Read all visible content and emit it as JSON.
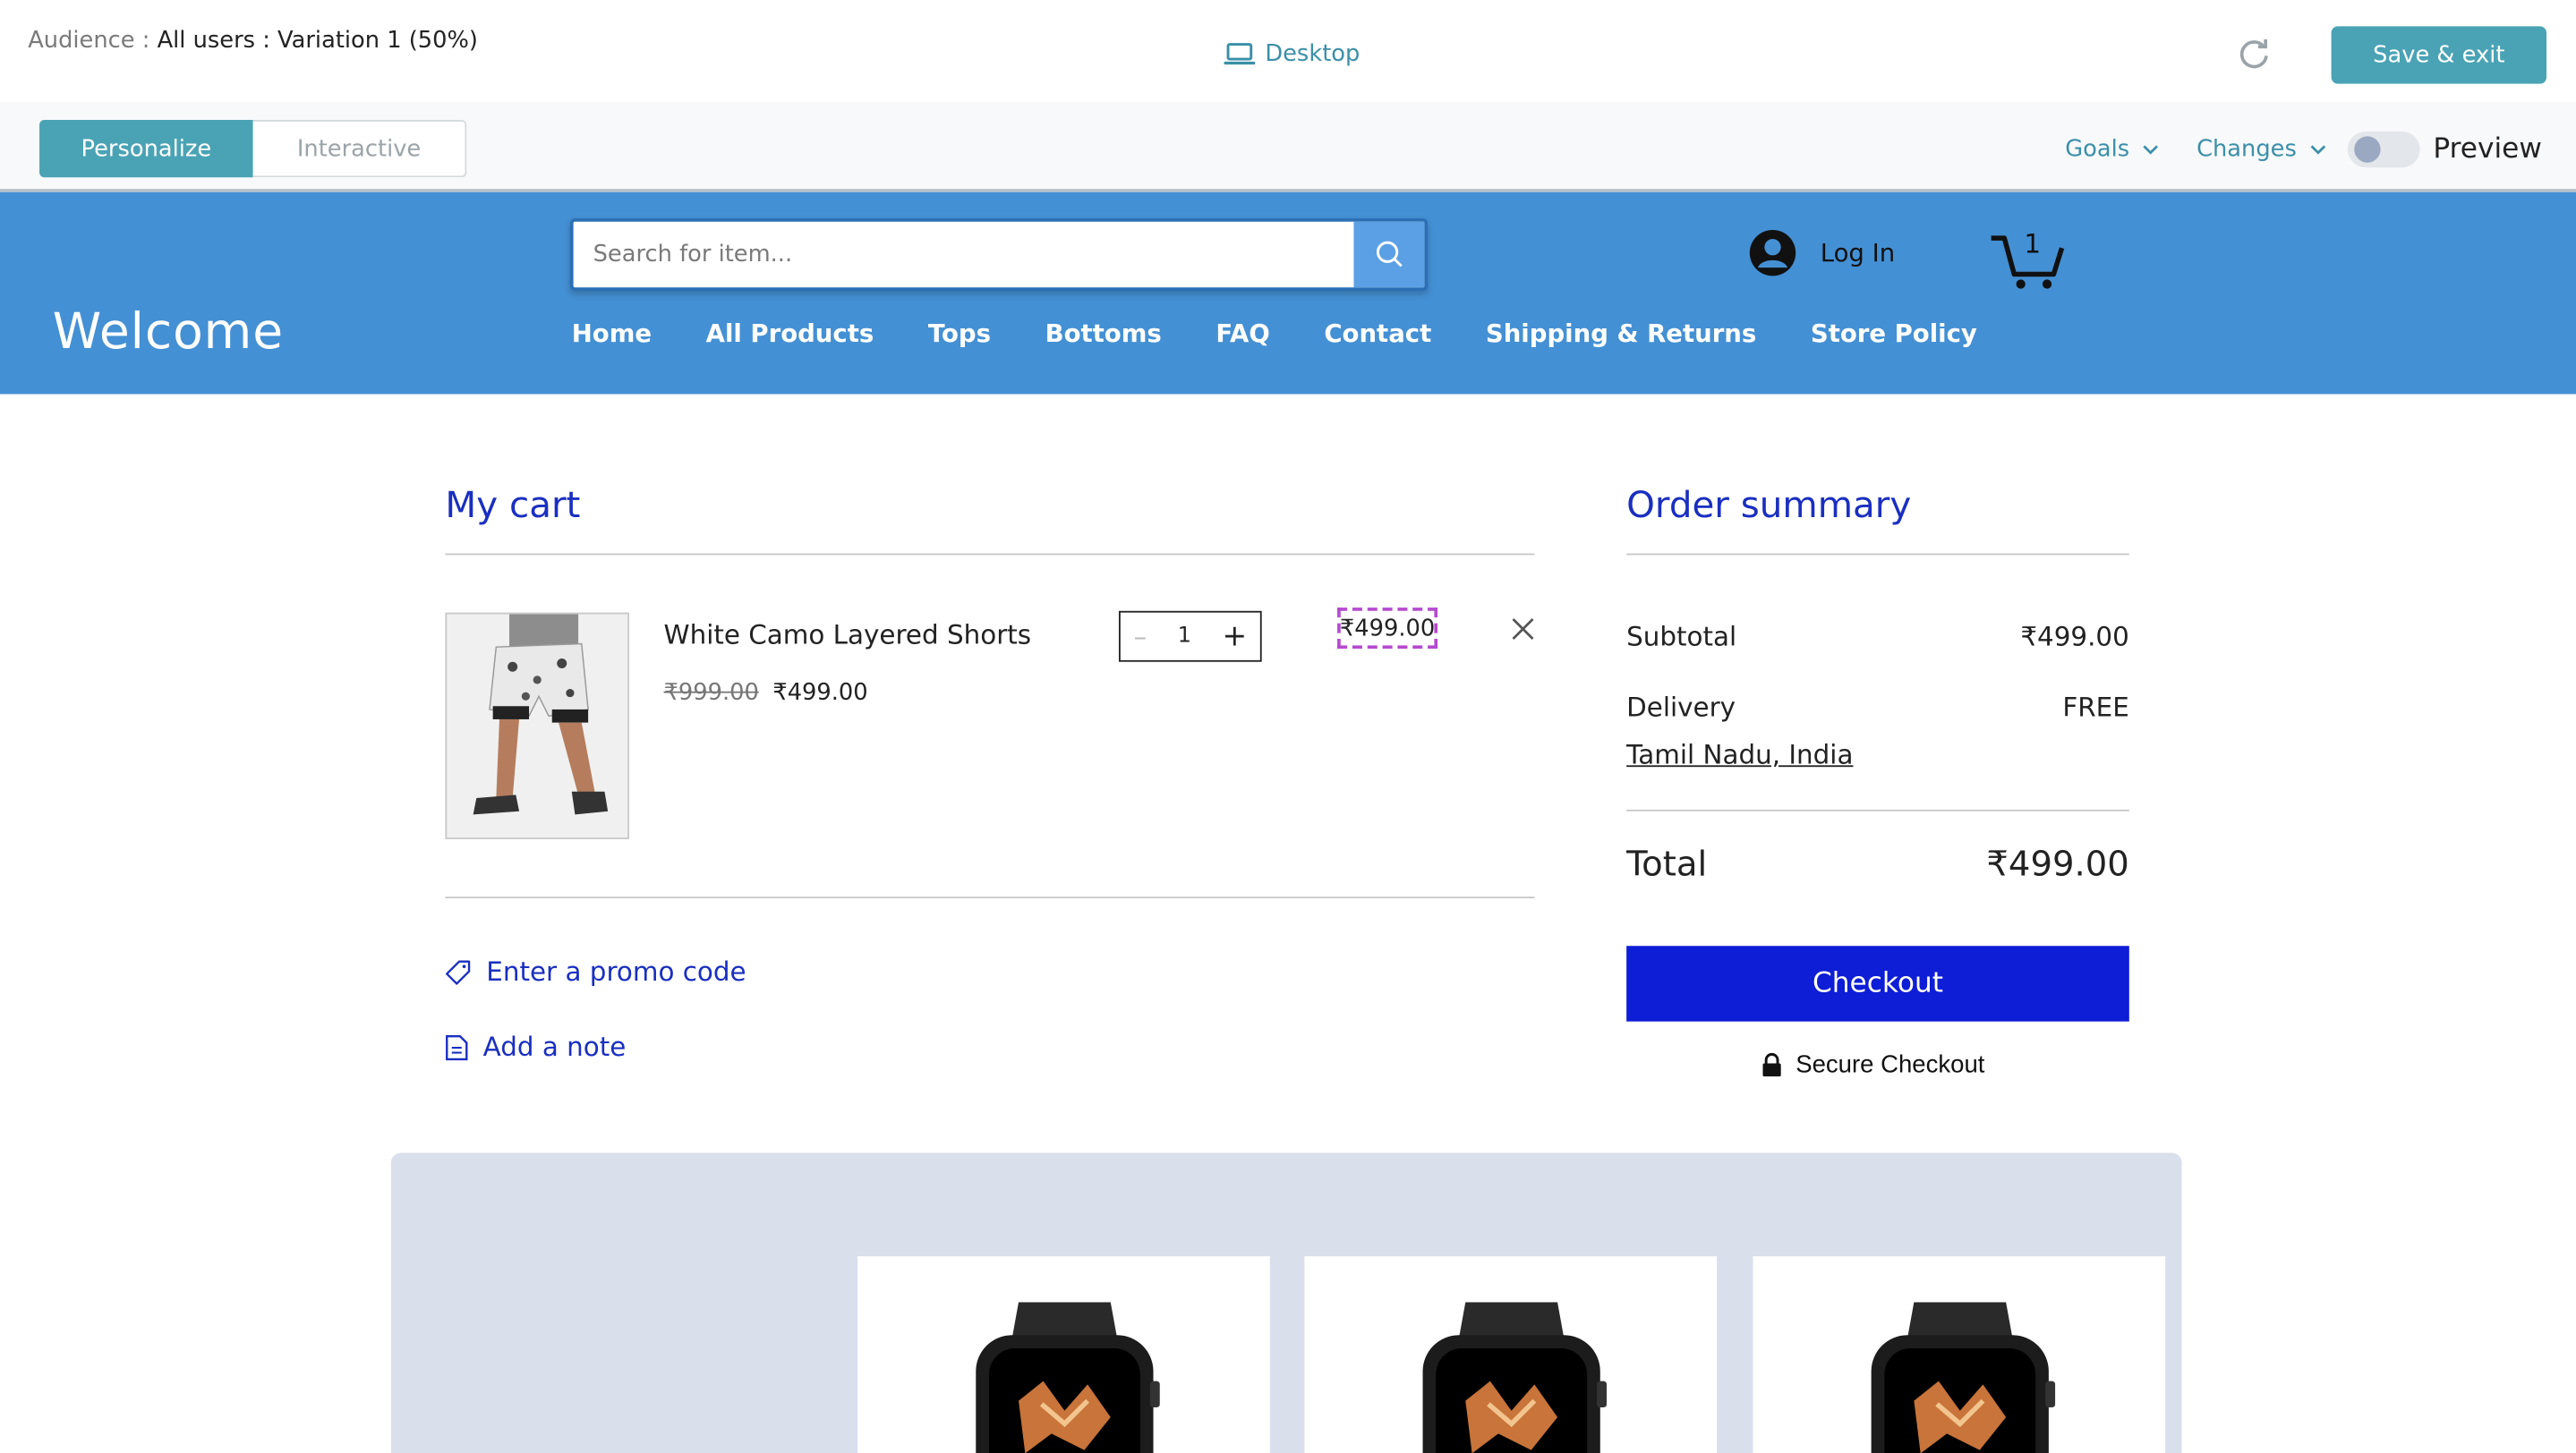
{
  "editor": {
    "audience_label": "Audience :",
    "audience_value": "All users : Variation 1 (50%)",
    "device_label": "Desktop",
    "save_label": "Save & exit",
    "tab_personalize": "Personalize",
    "tab_interactive": "Interactive",
    "goals_label": "Goals",
    "changes_label": "Changes",
    "preview_label": "Preview",
    "preview_on": false
  },
  "site": {
    "brand": "Welcome",
    "search_placeholder": "Search for item...",
    "login_label": "Log In",
    "cart_count": "1",
    "nav": [
      "Home",
      "All Products",
      "Tops",
      "Bottoms",
      "FAQ",
      "Contact",
      "Shipping & Returns",
      "Store Policy"
    ]
  },
  "cart": {
    "title": "My cart",
    "item": {
      "name": "White Camo Layered Shorts",
      "original_price": "₹999.00",
      "price": "₹499.00",
      "quantity": "1",
      "line_total": "₹499.00"
    },
    "promo_label": "Enter a promo code",
    "note_label": "Add a note"
  },
  "summary": {
    "title": "Order summary",
    "subtotal_label": "Subtotal",
    "subtotal_value": "₹499.00",
    "delivery_label": "Delivery",
    "delivery_value": "FREE",
    "region": "Tamil Nadu, India",
    "total_label": "Total",
    "total_value": "₹499.00",
    "checkout_label": "Checkout",
    "secure_label": "Secure Checkout"
  },
  "colors": {
    "accent_teal": "#4aa3b5",
    "header_blue": "#4490d4",
    "text_blue": "#1a2fc0",
    "checkout_blue": "#0e1dd6",
    "related_bg": "#d9dfeb"
  }
}
